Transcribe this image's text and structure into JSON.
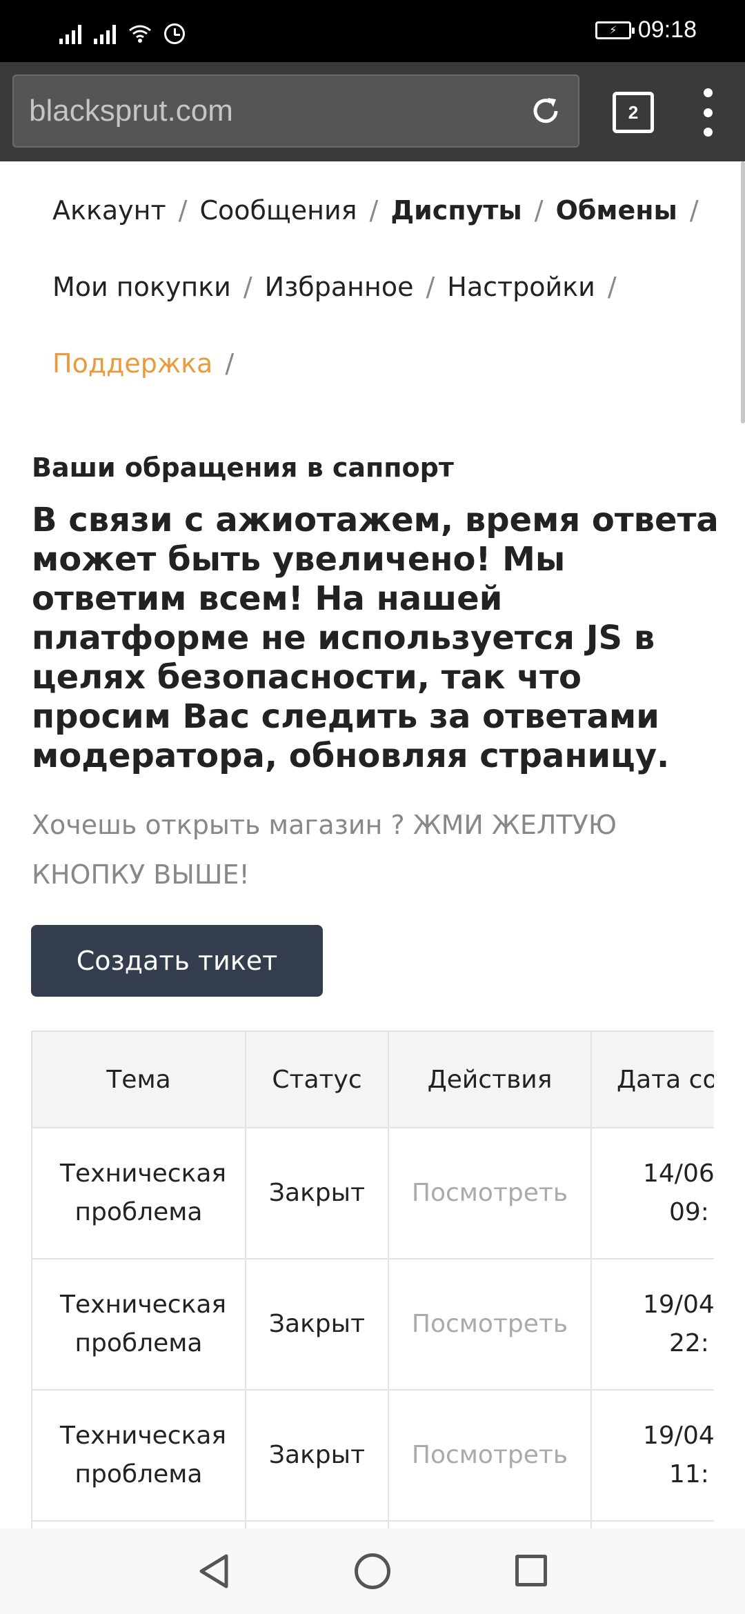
{
  "status_bar": {
    "time": "09:18",
    "icons": [
      "signal-icon",
      "signal-icon",
      "wifi-icon",
      "alarm-icon",
      "battery-charging-icon"
    ]
  },
  "browser": {
    "url": "blacksprut.com",
    "tab_count": "2",
    "icons": [
      "reload-icon",
      "tabs-icon",
      "overflow-menu-icon"
    ]
  },
  "nav": {
    "separator": "/",
    "items": [
      {
        "label": "Аккаунт"
      },
      {
        "label": "Сообщения"
      },
      {
        "label": "Диспуты"
      },
      {
        "label": "Обмены"
      },
      {
        "label": "Мои покупки"
      },
      {
        "label": "Избранное"
      },
      {
        "label": "Настройки"
      },
      {
        "label": "Поддержка"
      }
    ],
    "active_color": "#e99a3c"
  },
  "content": {
    "section_title": "Ваши обращения в саппорт",
    "notice": "В связи с ажиотажем, время ответа может быть увеличено! Мы ответим всем! На нашей платформе не используется JS в целях безопасности, так что просим Вас следить за ответами модератора, обновляя страницу.",
    "promo": "Хочешь открыть магазин ? ЖМИ ЖЕЛТУЮ КНОПКУ ВЫШЕ!",
    "create_button": "Создать тикет",
    "button_color": "#343d4e"
  },
  "table": {
    "headers": [
      "Тема",
      "Статус",
      "Действия",
      "Дата со"
    ],
    "rows": [
      {
        "topic": "Техническая проблема",
        "status": "Закрыт",
        "action": "Посмотреть",
        "date_line1": "14/06",
        "date_line2": "09:"
      },
      {
        "topic": "Техническая проблема",
        "status": "Закрыт",
        "action": "Посмотреть",
        "date_line1": "19/04",
        "date_line2": "22:"
      },
      {
        "topic": "Техническая проблема",
        "status": "Закрыт",
        "action": "Посмотреть",
        "date_line1": "19/04",
        "date_line2": "11:"
      }
    ]
  },
  "system_nav": {
    "icons": [
      "back-icon",
      "home-icon",
      "recent-apps-icon"
    ]
  }
}
